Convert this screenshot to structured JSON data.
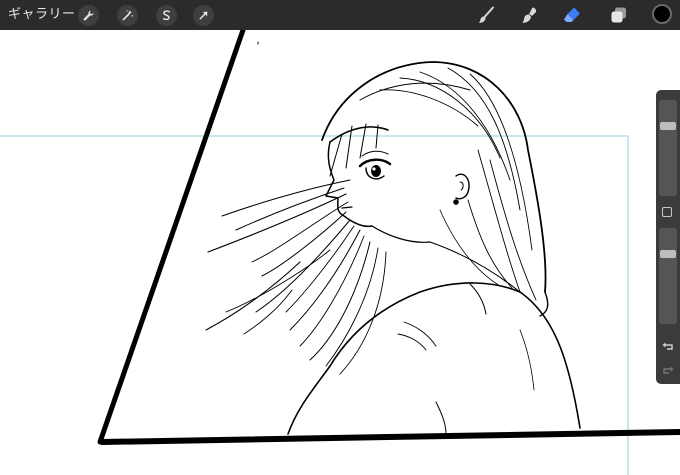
{
  "topbar": {
    "gallery_label": "ギャラリー",
    "left_tools": [
      "wrench-icon",
      "magic-wand-icon",
      "selection-icon",
      "transform-arrow-icon"
    ],
    "right_tools": [
      "brush-icon",
      "smudge-icon",
      "eraser-icon",
      "layers-icon"
    ],
    "active_tool": "eraser-icon",
    "current_color": "#000000",
    "accent_color": "#3d7cf5"
  },
  "sidebar": {
    "size_slider_value": 0.25,
    "opacity_slider_value": 0.25,
    "icons": [
      "modify-square-icon",
      "undo-icon",
      "redo-icon"
    ]
  }
}
